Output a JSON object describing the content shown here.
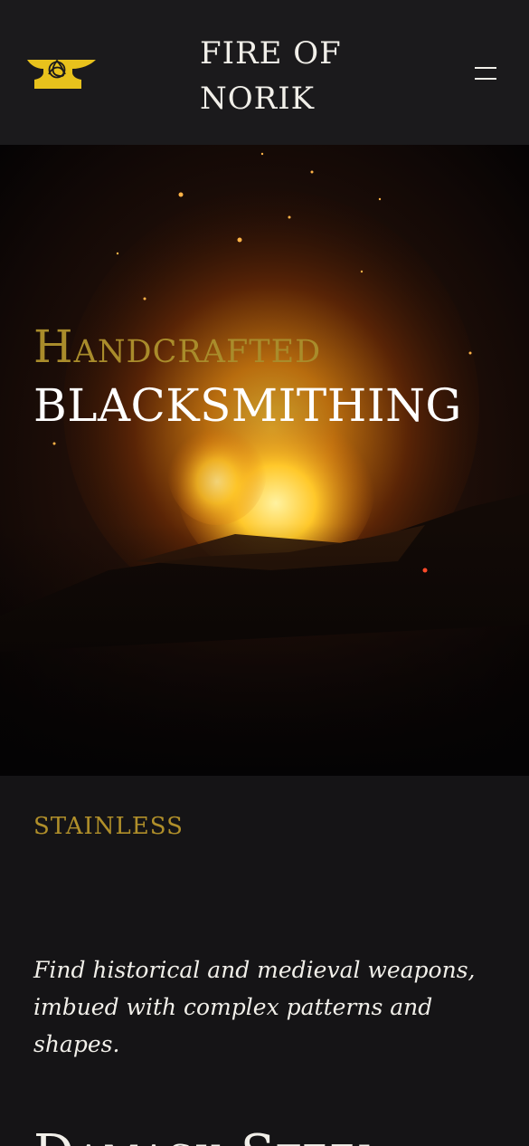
{
  "header": {
    "logo_icon": "anvil-triquetra-logo",
    "logo_color": "#e8c21c",
    "brand_line1": "FIRE OF",
    "brand_line2": "NORIK",
    "menu_icon": "hamburger-menu-icon"
  },
  "hero": {
    "image": "blacksmith-forge-fire-photo",
    "title_line1": "Handcrafted",
    "title_line2": "BLACKSMITHING",
    "accent_color": "#a98c2b"
  },
  "content": {
    "eyebrow": "STAINLESS",
    "description": "Find historical and medieval weapons, imbued with complex patterns and shapes.",
    "section_heading": "Damask Steel"
  }
}
